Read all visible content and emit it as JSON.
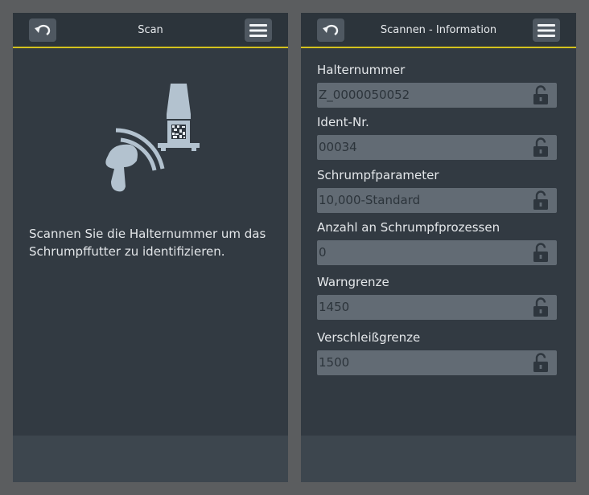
{
  "left_panel": {
    "title": "Scan",
    "back_icon": "undo-arrow-icon",
    "menu_icon": "hamburger-menu-icon",
    "illustration": "barcode-scanner-icon",
    "message": "Scannen Sie die Halternummer um das Schrumpffutter zu identifizieren."
  },
  "right_panel": {
    "title": "Scannen - Information",
    "back_icon": "undo-arrow-icon",
    "menu_icon": "hamburger-menu-icon",
    "fields": [
      {
        "label": "Halternummer",
        "value": "Z_0000050052",
        "icon": "lock-icon"
      },
      {
        "label": "Ident-Nr.",
        "value": "00034",
        "icon": "lock-icon"
      },
      {
        "label": "Schrumpfparameter",
        "value": "10,000-Standard",
        "icon": "lock-icon"
      },
      {
        "label": "Anzahl an Schrumpfprozessen",
        "value": "0",
        "icon": "lock-icon"
      },
      {
        "label": "Warngrenze",
        "value": "1450",
        "icon": "lock-icon"
      },
      {
        "label": "Verschleißgrenze",
        "value": "1500",
        "icon": "lock-icon"
      }
    ]
  },
  "colors": {
    "background": "#5b5d5f",
    "panel": "#323a42",
    "topbar": "#2c343b",
    "accent_line": "#d4c21e",
    "button": "#4f5861",
    "field": "#626b74",
    "footer": "#3d464e"
  }
}
